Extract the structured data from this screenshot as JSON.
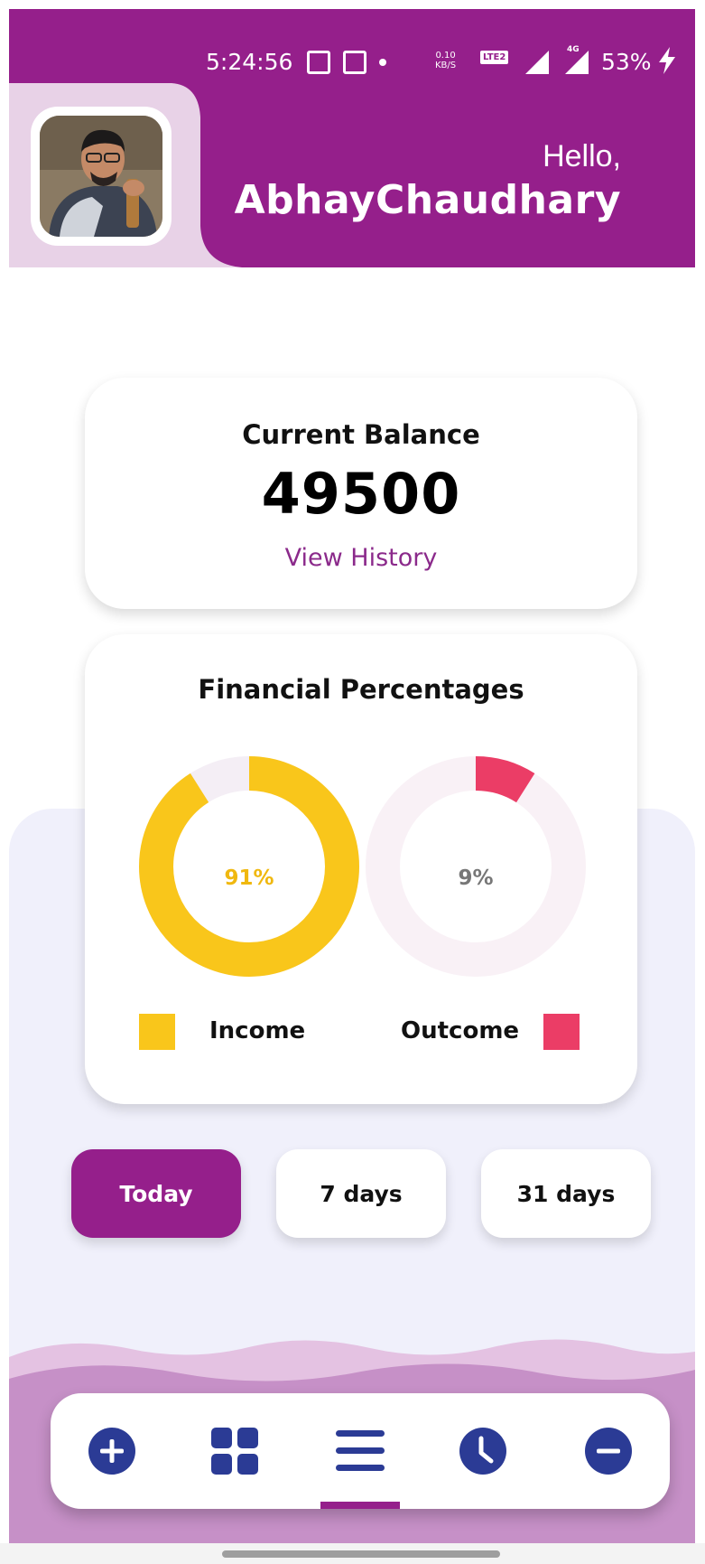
{
  "status_bar": {
    "time": "5:24:56",
    "net_speed_value": "0.10",
    "net_speed_unit": "KB/S",
    "volte": "LTE2",
    "network_type": "4G",
    "battery": "53%"
  },
  "header": {
    "greeting": "Hello,",
    "user_name": "AbhayChaudhary"
  },
  "balance_card": {
    "title": "Current Balance",
    "value": "49500",
    "history_link": "View History"
  },
  "financial_card": {
    "title": "Financial Percentages",
    "income_percent_label": "91%",
    "outcome_percent_label": "9%",
    "legend_income": "Income",
    "legend_outcome": "Outcome"
  },
  "chart_data": {
    "type": "pie",
    "charts": [
      {
        "label": "91%",
        "value": 91,
        "color": "#f9c61b",
        "track_color": "#f4eef5",
        "name": "Income"
      },
      {
        "label": "9%",
        "value": 9,
        "color": "#eb3d66",
        "track_color": "#f9f1f6",
        "name": "Outcome"
      }
    ]
  },
  "period_buttons": {
    "today": "Today",
    "seven_days": "7 days",
    "thirty_one_days": "31 days",
    "selected": "today"
  },
  "bottom_nav": {
    "items": [
      "add-icon",
      "dashboard-grid-icon",
      "menu-list-icon",
      "clock-icon",
      "remove-icon"
    ],
    "selected_index": 2
  },
  "colors": {
    "brand_purple": "#951f8b",
    "income_yellow": "#f9c61b",
    "outcome_pink": "#eb3d66",
    "nav_icon_blue": "#2b3b95",
    "wave_light": "#e4c2e2",
    "wave_dark": "#c690c7"
  }
}
